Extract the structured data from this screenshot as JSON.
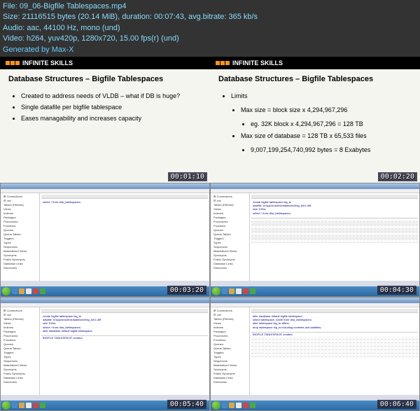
{
  "header": {
    "file_line": "File: 09_06-Bigfile Tablespaces.mp4",
    "size_line": "Size: 21116515 bytes (20.14 MiB), duration: 00:07:43, avg.bitrate: 365 kb/s",
    "audio_line": "Audio: aac, 44100 Hz, mono (und)",
    "video_line": "Video: h264, yuv420p, 1280x720, 15.00 fps(r) (und)",
    "generated_line": "Generated by Max-X"
  },
  "brand": "INFINITE SKILLS",
  "slide1": {
    "title": "Database Structures – Bigfile Tablespaces",
    "b1": "Created to address needs of VLDB – what if DB is huge?",
    "b2": "Single datafile per bigfile tablespace",
    "b3": "Eases managability and increases capacity"
  },
  "slide2": {
    "title": "Database Structures – Bigfile Tablespaces",
    "b1": "Limits",
    "b2": "Max size = block size x 4,294,967,296",
    "b3": "eg. 32K block x 4,294,967,296 = 128 TB",
    "b4": "Max size of database = 128 TB x 65,533 files",
    "b5": "9,007,199,254,740,992 bytes = 8 Exabytes"
  },
  "timestamps": {
    "t1": "00:01:10",
    "t2": "00:02:20",
    "t3": "00:03:20",
    "t4": "00:04:30",
    "t5": "00:05:40",
    "t6": "00:06:40"
  },
  "tree": {
    "i1": "⊞ Connections",
    "i2": "⊟ orcl",
    "i3": "  Tables (Filtered)",
    "i4": "  Views",
    "i5": "  Indexes",
    "i6": "  Packages",
    "i7": "  Procedures",
    "i8": "  Functions",
    "i9": "  Queues",
    "i10": "  Queue Tables",
    "i11": "  Triggers",
    "i12": "  Types",
    "i13": "  Sequences",
    "i14": "  Materialized Views",
    "i15": "  Synonyms",
    "i16": "  Public Synonyms",
    "i17": "  Database Links",
    "i18": "  Directories"
  },
  "sql": {
    "line1": "create bigfile tablespace big_ts",
    "line2": "datafile 'd:\\app\\oracle\\oradata\\orcl\\big_ts01.dbf'",
    "line3": "size 100m;",
    "line4": "select * from dba_tablespaces;",
    "line5": "alter database default bigfile tablespace;",
    "line6": "select tablespace_name from dba_tablespaces;",
    "line7": "alter tablespace big_ts offline;",
    "line8": "drop tablespace big_ts including contents and datafiles;",
    "line9": "BIGFILE TABLESPACE created."
  }
}
